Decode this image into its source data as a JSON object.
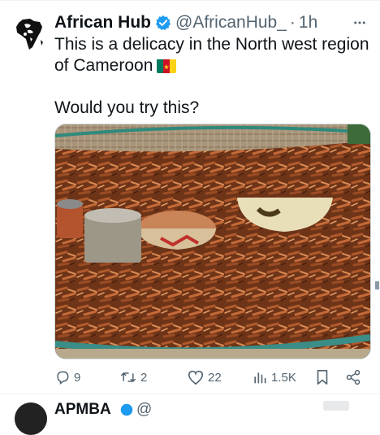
{
  "tweet": {
    "display_name": "African Hub",
    "handle": "@AfricanHub_",
    "separator": "·",
    "time": "1h",
    "text_line1": "This is a delicacy in the North west region",
    "text_line2": "of Cameroon",
    "text_line3": "Would you try this?",
    "flag_icon": "cameroon-flag-icon",
    "media_icon": "grasshoppers-basket-photo"
  },
  "actions": {
    "replies": "9",
    "reposts": "2",
    "likes": "22",
    "views": "1.5K"
  },
  "next_tweet": {
    "display_name": "APMBA",
    "handle": "@"
  },
  "colors": {
    "verified": "#1d9bf0",
    "muted": "#536471",
    "text": "#0f1419"
  }
}
